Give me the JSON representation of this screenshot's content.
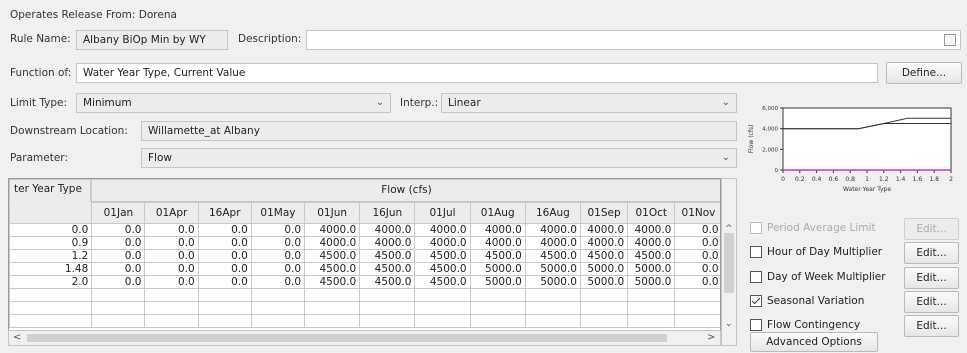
{
  "header": {
    "operates_text": "Operates Release From: Dorena",
    "rule_name_label": "Rule Name:",
    "rule_name_value": "Albany BiOp Min by WY",
    "description_label": "Description:",
    "description_value": ""
  },
  "function": {
    "label": "Function of:",
    "value": "Water Year Type, Current Value",
    "define_button": "Define..."
  },
  "limit": {
    "limit_type_label": "Limit Type:",
    "limit_type_value": "Minimum",
    "interp_label": "Interp.:",
    "interp_value": "Linear"
  },
  "location": {
    "downstream_label": "Downstream Location:",
    "downstream_value": "Willamette_at Albany",
    "parameter_label": "Parameter:",
    "parameter_value": "Flow"
  },
  "table": {
    "row_header": "ter Year Type",
    "group_header": "Flow (cfs)",
    "columns": [
      "01Jan",
      "01Apr",
      "16Apr",
      "01May",
      "01Jun",
      "16Jun",
      "01Jul",
      "01Aug",
      "16Aug",
      "01Sep",
      "01Oct",
      "01Nov"
    ],
    "rows": [
      {
        "key": "0.0",
        "values": [
          "0.0",
          "0.0",
          "0.0",
          "0.0",
          "4000.0",
          "4000.0",
          "4000.0",
          "4000.0",
          "4000.0",
          "4000.0",
          "4000.0",
          "0.0"
        ]
      },
      {
        "key": "0.9",
        "values": [
          "0.0",
          "0.0",
          "0.0",
          "0.0",
          "4000.0",
          "4000.0",
          "4000.0",
          "4000.0",
          "4000.0",
          "4000.0",
          "4000.0",
          "0.0"
        ]
      },
      {
        "key": "1.2",
        "values": [
          "0.0",
          "0.0",
          "0.0",
          "0.0",
          "4500.0",
          "4500.0",
          "4500.0",
          "4500.0",
          "4500.0",
          "4500.0",
          "4500.0",
          "0.0"
        ]
      },
      {
        "key": "1.48",
        "values": [
          "0.0",
          "0.0",
          "0.0",
          "0.0",
          "4500.0",
          "4500.0",
          "4500.0",
          "5000.0",
          "5000.0",
          "5000.0",
          "5000.0",
          "0.0"
        ]
      },
      {
        "key": "2.0",
        "values": [
          "0.0",
          "0.0",
          "0.0",
          "0.0",
          "4500.0",
          "4500.0",
          "4500.0",
          "5000.0",
          "5000.0",
          "5000.0",
          "5000.0",
          "0.0"
        ]
      }
    ]
  },
  "options": {
    "period_average_limit": {
      "label": "Period Average Limit",
      "checked": false,
      "enabled": false
    },
    "hour_of_day_multiplier": {
      "label": "Hour of Day Multiplier",
      "checked": false,
      "enabled": true
    },
    "day_of_week_multiplier": {
      "label": "Day of Week Multiplier",
      "checked": false,
      "enabled": true
    },
    "seasonal_variation": {
      "label": "Seasonal Variation",
      "checked": true,
      "enabled": true
    },
    "flow_contingency": {
      "label": "Flow Contingency",
      "checked": false,
      "enabled": true
    },
    "edit_label": "Edit...",
    "advanced_button": "Advanced Options"
  },
  "chart_data": {
    "type": "line",
    "title": "",
    "xlabel": "Water Year Type",
    "ylabel": "Flow (cfs)",
    "x_ticks": [
      "0",
      "0.2",
      "0.4",
      "0.6",
      "0.8",
      "1",
      "1.2",
      "1.4",
      "1.6",
      "1.8",
      "2"
    ],
    "y_ticks": [
      "0",
      "2,000",
      "4,000",
      "6,000"
    ],
    "xlim": [
      0,
      2
    ],
    "ylim": [
      0,
      6000
    ],
    "series": [
      {
        "x": [
          0,
          0.9,
          1.2,
          1.48,
          2.0
        ],
        "y": [
          4000,
          4000,
          4500,
          4500,
          4500
        ]
      },
      {
        "x": [
          0,
          0.9,
          1.2,
          1.48,
          2.0
        ],
        "y": [
          4000,
          4000,
          4500,
          5000,
          5000
        ]
      },
      {
        "x": [
          0,
          0.9,
          1.2,
          1.48,
          2.0
        ],
        "y": [
          0,
          0,
          0,
          0,
          0
        ]
      }
    ],
    "colors": [
      "#333333",
      "#333333",
      "#cc33cc"
    ]
  }
}
